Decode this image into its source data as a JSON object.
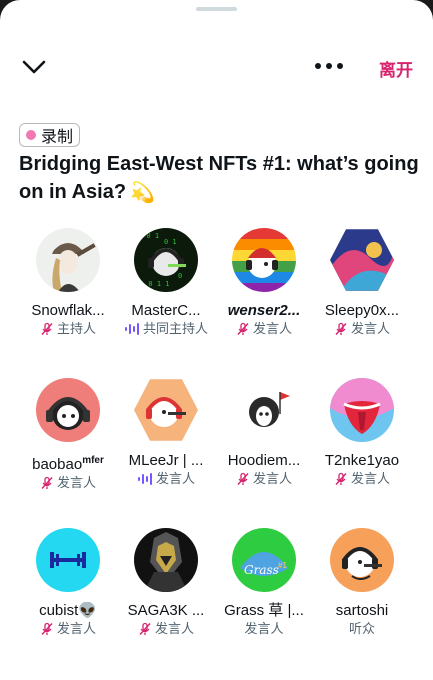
{
  "header": {
    "leave_label": "离开"
  },
  "space": {
    "tag_label": "录制",
    "title": "Bridging East-West NFTs #1: what’s going on in Asia?",
    "title_emoji": "💫"
  },
  "speakers": [
    {
      "name": "Snowflak...",
      "role": "主持人",
      "status": "muted"
    },
    {
      "name": "MasterC...",
      "role": "共同主持人",
      "status": "speaking"
    },
    {
      "name": "wenser2...",
      "role": "发言人",
      "status": "muted"
    },
    {
      "name": "Sleepy0x...",
      "role": "发言人",
      "status": "muted"
    },
    {
      "name": "baobao",
      "name_sup": "mfer",
      "role": "发言人",
      "status": "muted"
    },
    {
      "name": "MLeeJr | ...",
      "role": "发言人",
      "status": "speaking"
    },
    {
      "name": "Hoodiem...",
      "role": "发言人",
      "status": "muted"
    },
    {
      "name": "T2nke1yao",
      "role": "发言人",
      "status": "muted"
    },
    {
      "name": "cubist👽",
      "role": "发言人",
      "status": "muted"
    },
    {
      "name": "SAGA3K ...",
      "role": "发言人",
      "status": "muted"
    },
    {
      "name": "Grass 草 |...",
      "role": "发言人",
      "status": "none"
    },
    {
      "name": "sartoshi",
      "role": "听众",
      "status": "none"
    }
  ],
  "colors": {
    "accent": "#d6246e",
    "speaking": "#7856ff",
    "tag_dot": "#f278b2"
  }
}
